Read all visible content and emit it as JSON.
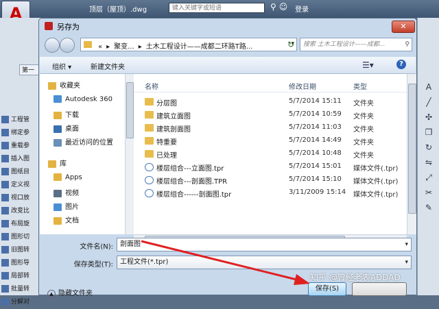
{
  "cad": {
    "title": "顶层（屋顶）.dwg",
    "search_placeholder": "键入关键字或短语",
    "login": "登录",
    "left_tab": "第一",
    "left_items": [
      "工程管",
      "绑定参",
      "重载参",
      "插入图",
      "图纸目",
      "定义视",
      "视口放",
      "改变比",
      "布局旋",
      "图形切",
      "旧图转",
      "图形导",
      "局部转",
      "批量转",
      "分解对"
    ]
  },
  "dialog": {
    "title": "另存为",
    "address": {
      "crumbs": [
        "«",
        "聚变...",
        "土木工程设计——成都二环路T路..."
      ]
    },
    "search_placeholder": "搜索 土木工程设计——成都...",
    "toolbar": {
      "organize": "组织 ▾",
      "new_folder": "新建文件夹"
    },
    "nav": [
      {
        "label": "收藏夹",
        "color": "#e3b341"
      },
      {
        "label": "Autodesk 360",
        "color": "#4a8fd4"
      },
      {
        "label": "下载",
        "color": "#e3b341"
      },
      {
        "label": "桌面",
        "color": "#3a6fb0"
      },
      {
        "label": "最近访问的位置",
        "color": "#6a8fb8"
      },
      {
        "label": "库",
        "color": "#e3b341"
      },
      {
        "label": "Apps",
        "color": "#e3b341"
      },
      {
        "label": "视频",
        "color": "#5a6f86"
      },
      {
        "label": "图片",
        "color": "#4a8fd4"
      },
      {
        "label": "文档",
        "color": "#e3b341"
      }
    ],
    "columns": {
      "name": "名称",
      "date": "修改日期",
      "type": "类型"
    },
    "files": [
      {
        "name": "分层图",
        "date": "5/7/2014 15:11",
        "type": "文件夹",
        "kind": "folder"
      },
      {
        "name": "建筑立面图",
        "date": "5/7/2014 10:59",
        "type": "文件夹",
        "kind": "folder"
      },
      {
        "name": "建筑剖面图",
        "date": "5/7/2014 11:03",
        "type": "文件夹",
        "kind": "folder"
      },
      {
        "name": "特重要",
        "date": "5/7/2014 14:49",
        "type": "文件夹",
        "kind": "folder"
      },
      {
        "name": "已处理",
        "date": "5/7/2014 10:48",
        "type": "文件夹",
        "kind": "folder"
      },
      {
        "name": "楼层组合---立面图.tpr",
        "date": "5/7/2014 15:01",
        "type": "媒体文件(.tpr)",
        "kind": "tpr"
      },
      {
        "name": "楼层组合---剖面图.TPR",
        "date": "5/7/2014 15:10",
        "type": "媒体文件(.tpr)",
        "kind": "tpr"
      },
      {
        "name": "楼层组合------剖面图.tpr",
        "date": "3/11/2009 15:14",
        "type": "媒体文件(.tpr)",
        "kind": "tpr"
      }
    ],
    "filename_label": "文件名(N):",
    "filename_value": "剖面图",
    "filetype_label": "保存类型(T):",
    "filetype_value": "工程文件(*.tpr)",
    "hide_folders": "隐藏文件夹",
    "save_label": "保存(S)"
  },
  "watermark": "知乎 @曾经老表ADDAD",
  "colors": {
    "arrow": "#e02020",
    "accent": "#3c7fb1"
  }
}
